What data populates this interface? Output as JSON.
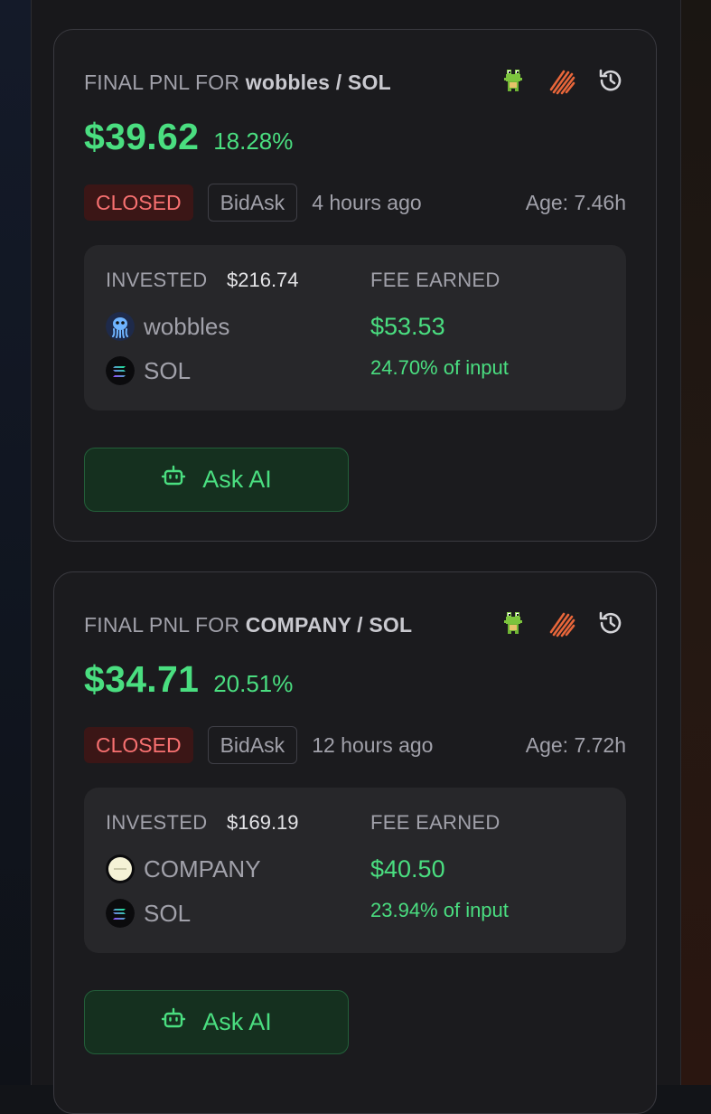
{
  "positions": [
    {
      "title_prefix": "FINAL PNL FOR",
      "pair": "wobbles / SOL",
      "pnl_value": "$39.62",
      "pnl_pct": "18.28%",
      "status": "CLOSED",
      "strategy": "BidAsk",
      "time_ago": "4 hours ago",
      "age": "Age: 7.46h",
      "invested_label": "INVESTED",
      "invested_value": "$216.74",
      "fee_label": "FEE EARNED",
      "fee_value": "$53.53",
      "fee_pct": "24.70% of input",
      "token_a": "wobbles",
      "token_b": "SOL",
      "button_label": "Ask AI",
      "icons": [
        "gecko-icon",
        "meteora-icon",
        "history-icon"
      ]
    },
    {
      "title_prefix": "FINAL PNL FOR",
      "pair": "COMPANY / SOL",
      "pnl_value": "$34.71",
      "pnl_pct": "20.51%",
      "status": "CLOSED",
      "strategy": "BidAsk",
      "time_ago": "12 hours ago",
      "age": "Age: 7.72h",
      "invested_label": "INVESTED",
      "invested_value": "$169.19",
      "fee_label": "FEE EARNED",
      "fee_value": "$40.50",
      "fee_pct": "23.94% of input",
      "token_a": "COMPANY",
      "token_b": "SOL",
      "button_label": "Ask AI",
      "icons": [
        "gecko-icon",
        "meteora-icon",
        "history-icon"
      ]
    }
  ],
  "colors": {
    "positive": "#4ade80",
    "closed_badge_bg": "#3b1616",
    "closed_badge_text": "#f87171",
    "card_bg": "#1b1b1e"
  }
}
